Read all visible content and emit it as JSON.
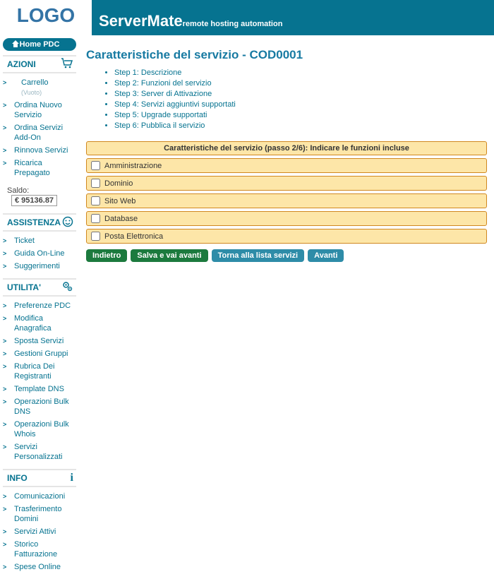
{
  "brand": {
    "logo": "LOGO",
    "product": "ServerMate",
    "tagline": "remote hosting automation"
  },
  "home_label": "Home PDC",
  "sidebar": {
    "azioni": {
      "title": "AZIONI",
      "items": [
        "Carrello",
        "Ordina Nuovo Servizio",
        "Ordina Servizi Add-On",
        "Rinnova Servizi",
        "Ricarica Prepagato"
      ],
      "carrello_suffix": "(Vuoto)",
      "saldo_label": "Saldo:",
      "saldo_value": "€ 95136.87"
    },
    "assistenza": {
      "title": "ASSISTENZA",
      "items": [
        "Ticket",
        "Guida On-Line",
        "Suggerimenti"
      ]
    },
    "utilita": {
      "title": "UTILITA'",
      "items": [
        "Preferenze PDC",
        "Modifica Anagrafica",
        "Sposta Servizi",
        "Gestioni Gruppi",
        "Rubrica Dei Registranti",
        "Template DNS",
        "Operazioni Bulk DNS",
        "Operazioni Bulk Whois",
        "Servizi Personalizzati"
      ]
    },
    "info": {
      "title": "INFO",
      "items": [
        "Comunicazioni",
        "Trasferimento Domini",
        "Servizi Attivi",
        "Storico Fatturazione",
        "Spese Online"
      ]
    }
  },
  "page": {
    "title": "Caratteristiche del servizio - COD0001",
    "steps": [
      "Step 1: Descrizione",
      "Step 2: Funzioni del servizio",
      "Step 3: Server di Attivazione",
      "Step 4: Servizi aggiuntivi supportati",
      "Step 5: Upgrade supportati",
      "Step 6: Pubblica il servizio"
    ],
    "panel_title": "Caratteristiche del servizio (passo 2/6): Indicare le funzioni incluse",
    "functions": [
      "Amministrazione",
      "Dominio",
      "Sito Web",
      "Database",
      "Posta Elettronica"
    ],
    "buttons": {
      "back": "Indietro",
      "save_next": "Salva e vai avanti",
      "to_list": "Torna alla lista servizi",
      "next": "Avanti"
    }
  }
}
